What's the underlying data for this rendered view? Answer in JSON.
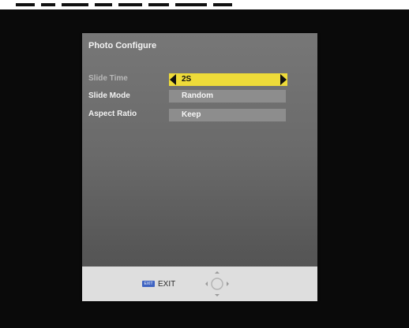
{
  "dialog": {
    "title": "Photo Configure"
  },
  "settings": [
    {
      "label": "Slide Time",
      "value": "2S",
      "selected": true
    },
    {
      "label": "Slide Mode",
      "value": "Random",
      "selected": false
    },
    {
      "label": "Aspect Ratio",
      "value": "Keep",
      "selected": false
    }
  ],
  "footer": {
    "exit_key_label": "EXIT",
    "exit_label": "EXIT",
    "nav_icon": "dpad-icon"
  },
  "colors": {
    "highlight": "#eedb39",
    "panel": "#6e6e6e",
    "field": "#8d8d8d",
    "footer": "#dedede",
    "exit_key": "#3e63c2"
  }
}
